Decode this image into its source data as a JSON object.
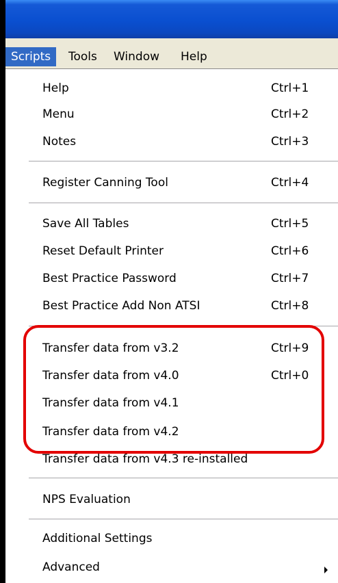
{
  "menubar": {
    "items": [
      {
        "label": "Scripts"
      },
      {
        "label": "Tools"
      },
      {
        "label": "Window"
      },
      {
        "label": "Help"
      }
    ]
  },
  "menu": {
    "groups": [
      [
        {
          "label": "Help",
          "shortcut": "Ctrl+1"
        },
        {
          "label": "Menu",
          "shortcut": "Ctrl+2"
        },
        {
          "label": "Notes",
          "shortcut": "Ctrl+3"
        }
      ],
      [
        {
          "label": "Register Canning Tool",
          "shortcut": "Ctrl+4"
        }
      ],
      [
        {
          "label": "Save All Tables",
          "shortcut": "Ctrl+5"
        },
        {
          "label": "Reset Default Printer",
          "shortcut": "Ctrl+6"
        },
        {
          "label": "Best Practice Password",
          "shortcut": "Ctrl+7"
        },
        {
          "label": "Best Practice Add Non ATSI",
          "shortcut": "Ctrl+8"
        }
      ],
      [
        {
          "label": "Transfer data from v3.2",
          "shortcut": "Ctrl+9"
        },
        {
          "label": "Transfer data from v4.0",
          "shortcut": "Ctrl+0"
        },
        {
          "label": "Transfer data from v4.1",
          "shortcut": ""
        },
        {
          "label": "Transfer data from v4.2",
          "shortcut": ""
        },
        {
          "label": "Transfer data from v4.3 re-installed",
          "shortcut": ""
        }
      ],
      [
        {
          "label": "NPS Evaluation",
          "shortcut": ""
        }
      ],
      [
        {
          "label": "Additional Settings",
          "shortcut": ""
        },
        {
          "label": "Advanced",
          "shortcut": ""
        }
      ]
    ]
  },
  "colors": {
    "highlight_outline": "#e30000",
    "active_menu": "#316ac5",
    "titlebar": "#0a4fd0"
  }
}
